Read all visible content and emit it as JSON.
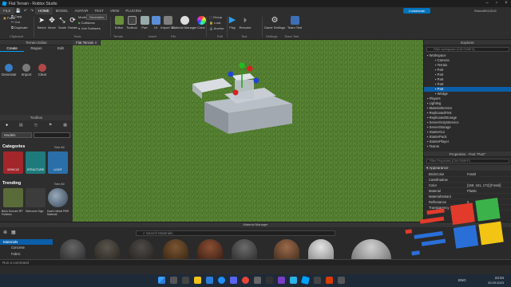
{
  "window": {
    "title": "Flat Terrain - Roblox Studio",
    "file_menu": "FILE",
    "menu_tabs": [
      "HOME",
      "MODEL",
      "AVATAR",
      "TEST",
      "VIEW",
      "PLUGINS"
    ],
    "active_tab": "HOME",
    "collaborate": "Collaborate",
    "user": "Robert5012015"
  },
  "ribbon": {
    "clipboard": [
      "Paste",
      "Copy",
      "Cut",
      "Duplicate"
    ],
    "clipboard_group": "Clipboard",
    "tools": [
      "Select",
      "Move",
      "Scale",
      "Rotate"
    ],
    "mode_label": "Mode",
    "mode_value": "Geometric",
    "collisions": "Collisions",
    "join_surfaces": "Join Surfaces",
    "tools_group": "Tools",
    "terrain": [
      "Editor",
      "Toolbox"
    ],
    "terrain_group": "Terrain",
    "insert": [
      "Part",
      "UI",
      "Import 3D",
      "Material Manager",
      "Color"
    ],
    "insert_group": "Insert",
    "file_group": "File",
    "edit_group": "Edit",
    "edit_items": [
      "Group",
      "Lock",
      "Anchor"
    ],
    "test": [
      "Play",
      "Resume"
    ],
    "test_group": "Test",
    "settings": "Game Settings",
    "settings_group": "Settings",
    "team_test": "Team Test",
    "team_group": "Team Test"
  },
  "terrain_editor": {
    "header": "Terrain Editor",
    "tabs": [
      "Create",
      "Region",
      "Edit"
    ],
    "tools": [
      "Generate",
      "Import",
      "Clear"
    ]
  },
  "toolbox": {
    "header": "Toolbox",
    "models_label": "Models",
    "categories_title": "Categories",
    "see_all": "See All",
    "categories": [
      "VEHICLE",
      "STRUCTURE",
      "LIGHT"
    ],
    "trending_title": "Trending",
    "trending": [
      "Brick Domain RP Fullview",
      "Welcome Sign",
      "Kaal's Metal PBR Material"
    ]
  },
  "viewport": {
    "tab": "Flat Terrain"
  },
  "explorer": {
    "header": "Explorer",
    "filter_placeholder": "Filter workspace (Ctrl+Shift+X)",
    "items": [
      "Workspace",
      "Camera",
      "Terrain",
      "Part",
      "Part",
      "Part",
      "Part",
      "Part",
      "Wedge",
      "Players",
      "Lighting",
      "MaterialService",
      "ReplicatedFirst",
      "ReplicatedStorage",
      "ServerScriptService",
      "ServerStorage",
      "StarterGui",
      "StarterPack",
      "StarterPlayer",
      "Teams"
    ],
    "selected_index": 7
  },
  "properties": {
    "header": "Properties - Part \"Part\"",
    "filter_placeholder": "Filter Properties (Ctrl+Shift+P)",
    "section": "Appearance",
    "rows": [
      {
        "k": "BrickColor",
        "v": "Fossil"
      },
      {
        "k": "CastShadow",
        "v": ""
      },
      {
        "k": "Color",
        "v": "[159, 161, 172] [Fossil]"
      },
      {
        "k": "Material",
        "v": "Plastic"
      },
      {
        "k": "MaterialVariant",
        "v": ""
      },
      {
        "k": "Reflectance",
        "v": "0"
      },
      {
        "k": "Transparency",
        "v": "0"
      }
    ]
  },
  "material_manager": {
    "header": "Material Manager",
    "search_placeholder": "Search Materials",
    "tree": [
      "Materials",
      "Concrete",
      "Fabric"
    ]
  },
  "command_bar": {
    "placeholder": "Run a command"
  },
  "taskbar": {
    "lang": "ENG",
    "time": "23:34",
    "date": "20.09.2023"
  }
}
